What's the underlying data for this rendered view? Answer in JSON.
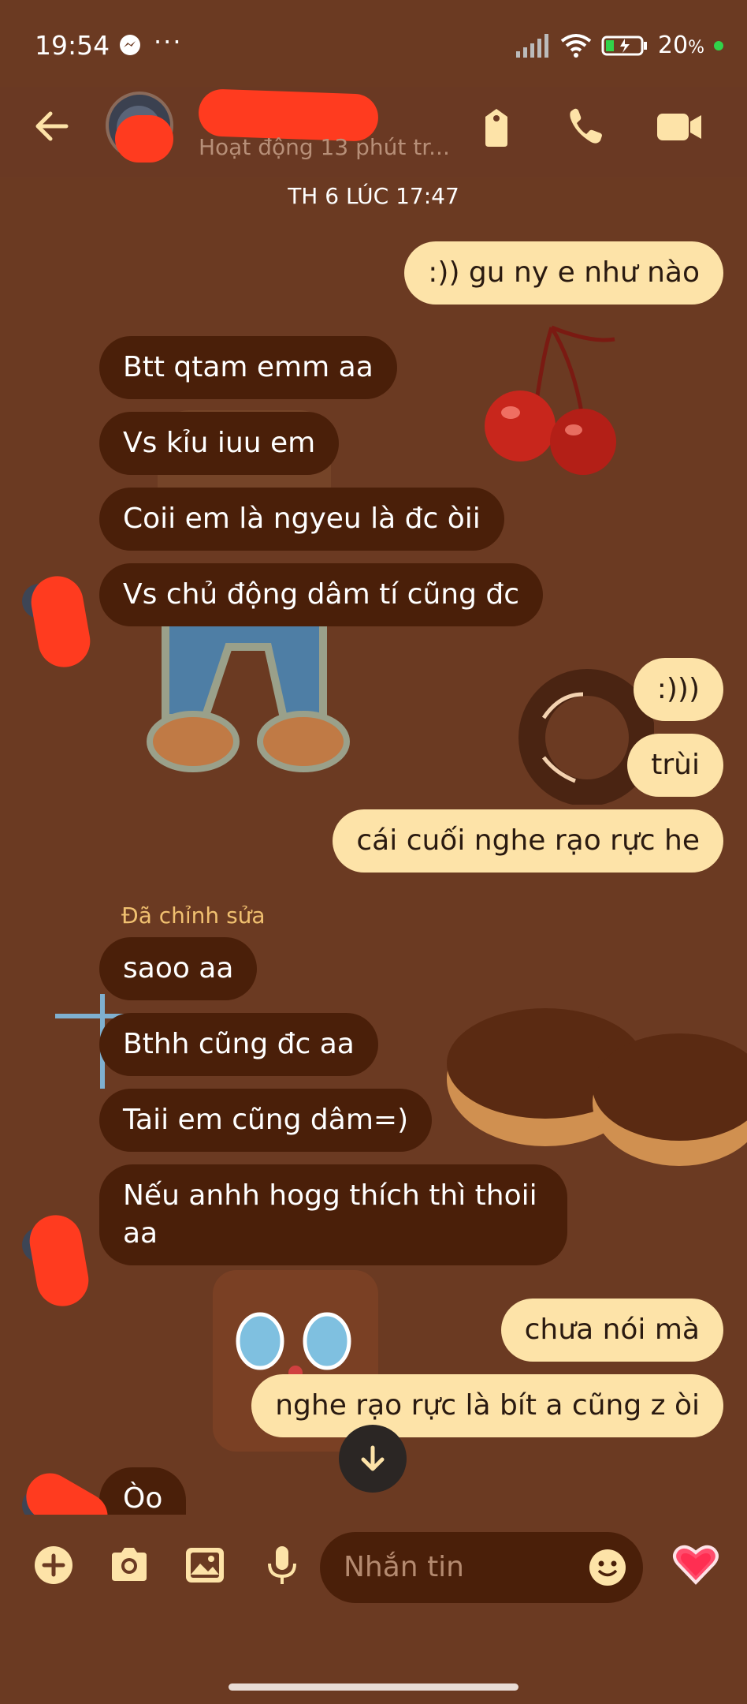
{
  "status_bar": {
    "time": "19:54",
    "more": "···",
    "battery": "20",
    "battery_unit": "%"
  },
  "header": {
    "contact_name": "",
    "activity": "Hoạt động 13 phút tr...",
    "icons": [
      "back-arrow-icon",
      "shop-bag-icon",
      "phone-icon",
      "video-icon"
    ]
  },
  "date_divider": "TH 6 LÚC 17:47",
  "messages": [
    {
      "side": "out",
      "text": ":)) gu ny e như nào"
    },
    {
      "side": "in",
      "text": "Btt qtam emm aa"
    },
    {
      "side": "in",
      "text": "Vs kỉu iuu em"
    },
    {
      "side": "in",
      "text": "Coii em là ngyeu là đc òii"
    },
    {
      "side": "in",
      "text": "Vs chủ động dâm tí cũng đc"
    },
    {
      "side": "out",
      "text": ":)))"
    },
    {
      "side": "out",
      "text": "trùi"
    },
    {
      "side": "out",
      "text": "cái cuối nghe rạo rực he"
    },
    {
      "side": "in",
      "text": "saoo aa"
    },
    {
      "side": "in",
      "text": "Bthh cũng đc aa"
    },
    {
      "side": "in",
      "text": "Taii em cũng dâm=)"
    },
    {
      "side": "in",
      "text": "Nếu anhh hogg thích thì thoii aa"
    },
    {
      "side": "out",
      "text": "chưa nói mà"
    },
    {
      "side": "out",
      "text": "nghe rạo rực là bít a cũng z òi"
    },
    {
      "side": "in",
      "text": "Òo"
    }
  ],
  "edited_label": "Đã chỉnh sửa",
  "composer": {
    "placeholder": "Nhắn tin",
    "icons": [
      "plus-icon",
      "camera-icon",
      "image-icon",
      "microphone-icon",
      "emoji-icon",
      "heart-icon"
    ]
  },
  "colors": {
    "background": "#6b3a22",
    "incoming_bubble": "#4a1f09",
    "outgoing_bubble": "#fde3a8",
    "accent": "#fde3a8"
  }
}
